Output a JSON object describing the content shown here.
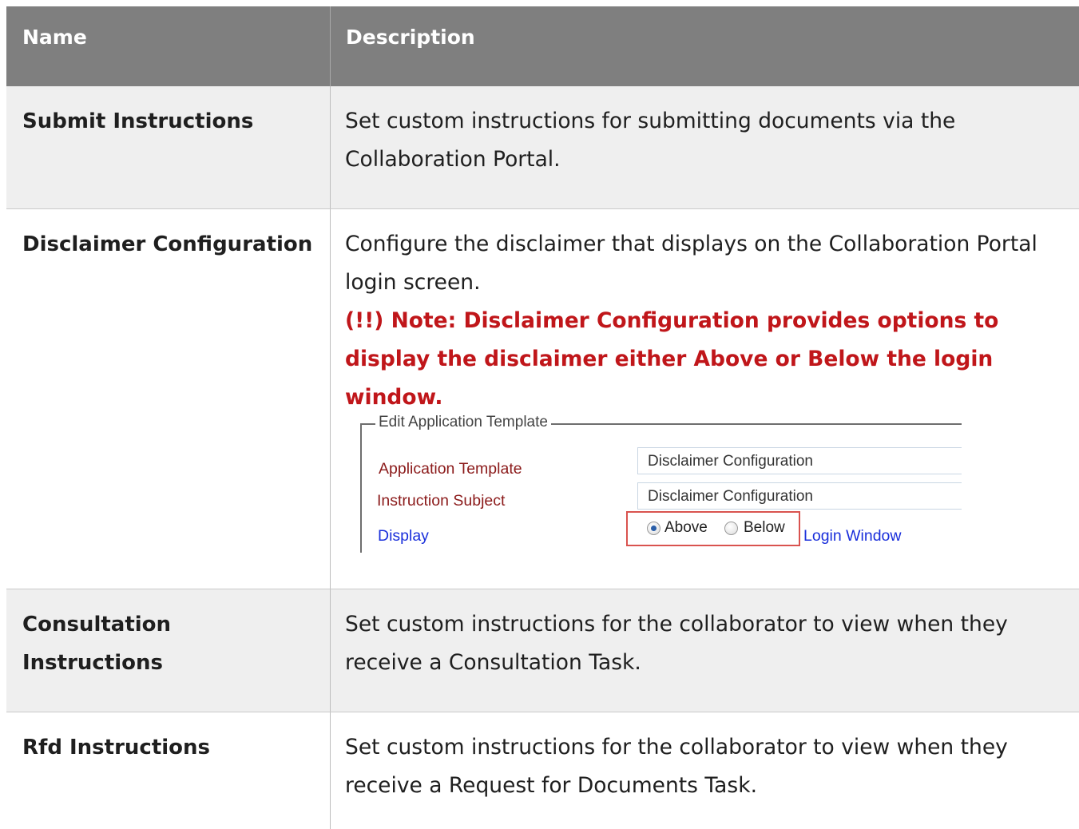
{
  "table": {
    "headers": {
      "name": "Name",
      "description": "Description"
    },
    "rows": [
      {
        "name": "Submit Instructions",
        "description": "Set custom instructions for submitting documents via the Collaboration Portal."
      },
      {
        "name": "Disclaimer Configuration",
        "description": "Configure the disclaimer that displays on the Collaboration Portal login screen.",
        "note": "(!!) Note: Disclaimer Configuration provides options to display the disclaimer either Above or Below the login window."
      },
      {
        "name": "Consultation Instructions",
        "description": "Set custom instructions for the collaborator to view when they receive a Consultation Task."
      },
      {
        "name": "Rfd Instructions",
        "description": "Set custom instructions for the collaborator to view when they receive a Request for Documents Task."
      }
    ]
  },
  "embedded_screenshot": {
    "legend": "Edit Application Template",
    "fields": [
      {
        "label": "Application Template",
        "value": "Disclaimer Configuration"
      },
      {
        "label": "Instruction Subject",
        "value": "Disclaimer Configuration"
      }
    ],
    "display": {
      "label": "Display",
      "options": [
        {
          "label": "Above",
          "selected": true
        },
        {
          "label": "Below",
          "selected": false
        }
      ],
      "suffix": "Login Window"
    }
  },
  "colors": {
    "header_bg": "#7f7f7f",
    "note_red": "#c0161a",
    "label_red": "#8b1a1a",
    "label_blue": "#1a2fdb",
    "highlight_box": "#d9534f"
  }
}
